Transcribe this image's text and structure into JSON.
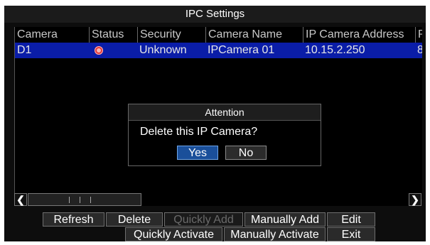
{
  "window": {
    "title": "IPC Settings"
  },
  "table": {
    "columns": [
      "Camera",
      "Status",
      "Security",
      "Camera Name",
      "IP Camera Address",
      "P"
    ],
    "rows": [
      {
        "camera": "D1",
        "status_icon": "error-status-icon",
        "security": "Unknown",
        "name": "IPCamera 01",
        "address": "10.15.2.250",
        "port": "8"
      }
    ]
  },
  "dialog": {
    "title": "Attention",
    "message": "Delete this IP Camera?",
    "yes_label": "Yes",
    "no_label": "No"
  },
  "scrollbar": {
    "left_icon": "chevron-left-icon",
    "right_icon": "chevron-right-icon"
  },
  "buttons": {
    "refresh": "Refresh",
    "delete": "Delete",
    "quickly_add": "Quickly Add",
    "manually_add": "Manually Add",
    "edit": "Edit",
    "quickly_activate": "Quickly Activate",
    "manually_activate": "Manually Activate",
    "exit": "Exit"
  },
  "colors": {
    "selection": "#0a1da8",
    "background": "#0d0d0d",
    "status_error": "#e23a3a"
  }
}
